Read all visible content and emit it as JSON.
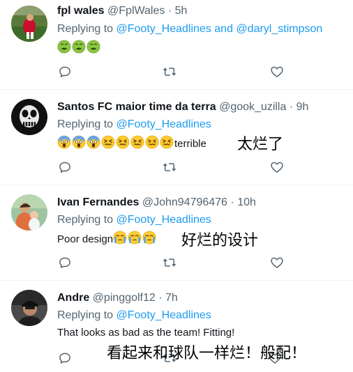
{
  "tweets": [
    {
      "display_name": "fpl wales",
      "handle": "@FplWales",
      "time": "5h",
      "reply_prefix": "Replying to",
      "mention_1": "@Footy_Headlines",
      "connector": "and",
      "mention_2": "@daryl_stimpson",
      "body_text": "",
      "emojis": [
        "nauseated-face",
        "nauseated-face",
        "nauseated-face"
      ],
      "annotation": ""
    },
    {
      "display_name": "Santos FC maior time da terra",
      "handle": "@gook_uzilla",
      "time": "9h",
      "reply_prefix": "Replying to",
      "mention_1": "@Footy_Headlines",
      "body_text": "terrible",
      "emojis": [
        "screaming-face",
        "screaming-face",
        "screaming-face",
        "confounded-face",
        "confounded-face",
        "confounded-face",
        "confounded-face",
        "confounded-face"
      ],
      "annotation": "太烂了"
    },
    {
      "display_name": "Ivan Fernandes",
      "handle": "@John94796476",
      "time": "10h",
      "reply_prefix": "Replying to",
      "mention_1": "@Footy_Headlines",
      "body_text": "Poor design",
      "emojis": [
        "crying-face",
        "crying-face",
        "crying-face"
      ],
      "annotation": "好烂的设计"
    },
    {
      "display_name": "Andre",
      "handle": "@pinggolf12",
      "time": "7h",
      "reply_prefix": "Replying to",
      "mention_1": "@Footy_Headlines",
      "body_text": "That looks as bad as the team! Fitting!",
      "emojis": [],
      "annotation": "看起来和球队一样烂！般配！"
    }
  ],
  "separator": "·",
  "actions": [
    "reply-icon",
    "retweet-icon",
    "like-icon"
  ],
  "colors": {
    "mention": "#1d9bf0",
    "muted": "#536471",
    "text": "#0f1419",
    "divider": "#eff3f4"
  }
}
